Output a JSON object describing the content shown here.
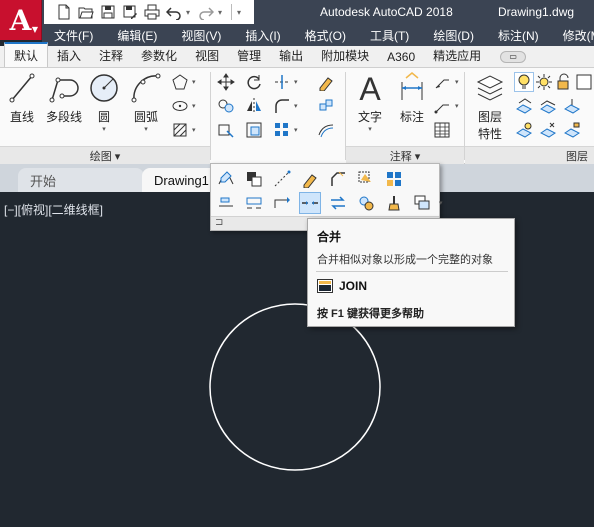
{
  "app": {
    "logo_letter": "A",
    "title": "Autodesk AutoCAD 2018",
    "file": "Drawing1.dwg",
    "brand_color": "#c8102e"
  },
  "qat": {
    "icons": [
      "new-icon",
      "open-icon",
      "save-icon",
      "saveas-icon",
      "print-icon",
      "undo-icon",
      "redo-icon"
    ]
  },
  "menubar": [
    "文件(F)",
    "编辑(E)",
    "视图(V)",
    "插入(I)",
    "格式(O)",
    "工具(T)",
    "绘图(D)",
    "标注(N)",
    "修改(M)"
  ],
  "ribbon_tabs": [
    "默认",
    "插入",
    "注释",
    "参数化",
    "视图",
    "管理",
    "输出",
    "附加模块",
    "A360",
    "精选应用"
  ],
  "ribbon_tab_pill": "▭",
  "draw_panel": {
    "tools": [
      "直线",
      "多段线",
      "圆",
      "圆弧"
    ],
    "footer": "绘图 ▾"
  },
  "annotation_panel": {
    "tools": [
      "文字",
      "标注"
    ],
    "footer": "注释 ▾"
  },
  "layers_panel": {
    "tool": "图层\n特性",
    "tool_line1": "图层",
    "tool_line2": "特性",
    "footer": "图层"
  },
  "file_tabs": {
    "start": "开始",
    "drawing": "Drawing1"
  },
  "viewport_label": "[−][俯视][二维线框]",
  "tooltip": {
    "title": "合并",
    "description": "合并相似对象以形成一个完整的对象",
    "command": "JOIN",
    "help": "按 F1 键获得更多帮助"
  },
  "colors": {
    "canvas": "#212830",
    "titlebar": "#3b4453",
    "ribbon": "#fafafa",
    "accent": "#1f76c8"
  }
}
